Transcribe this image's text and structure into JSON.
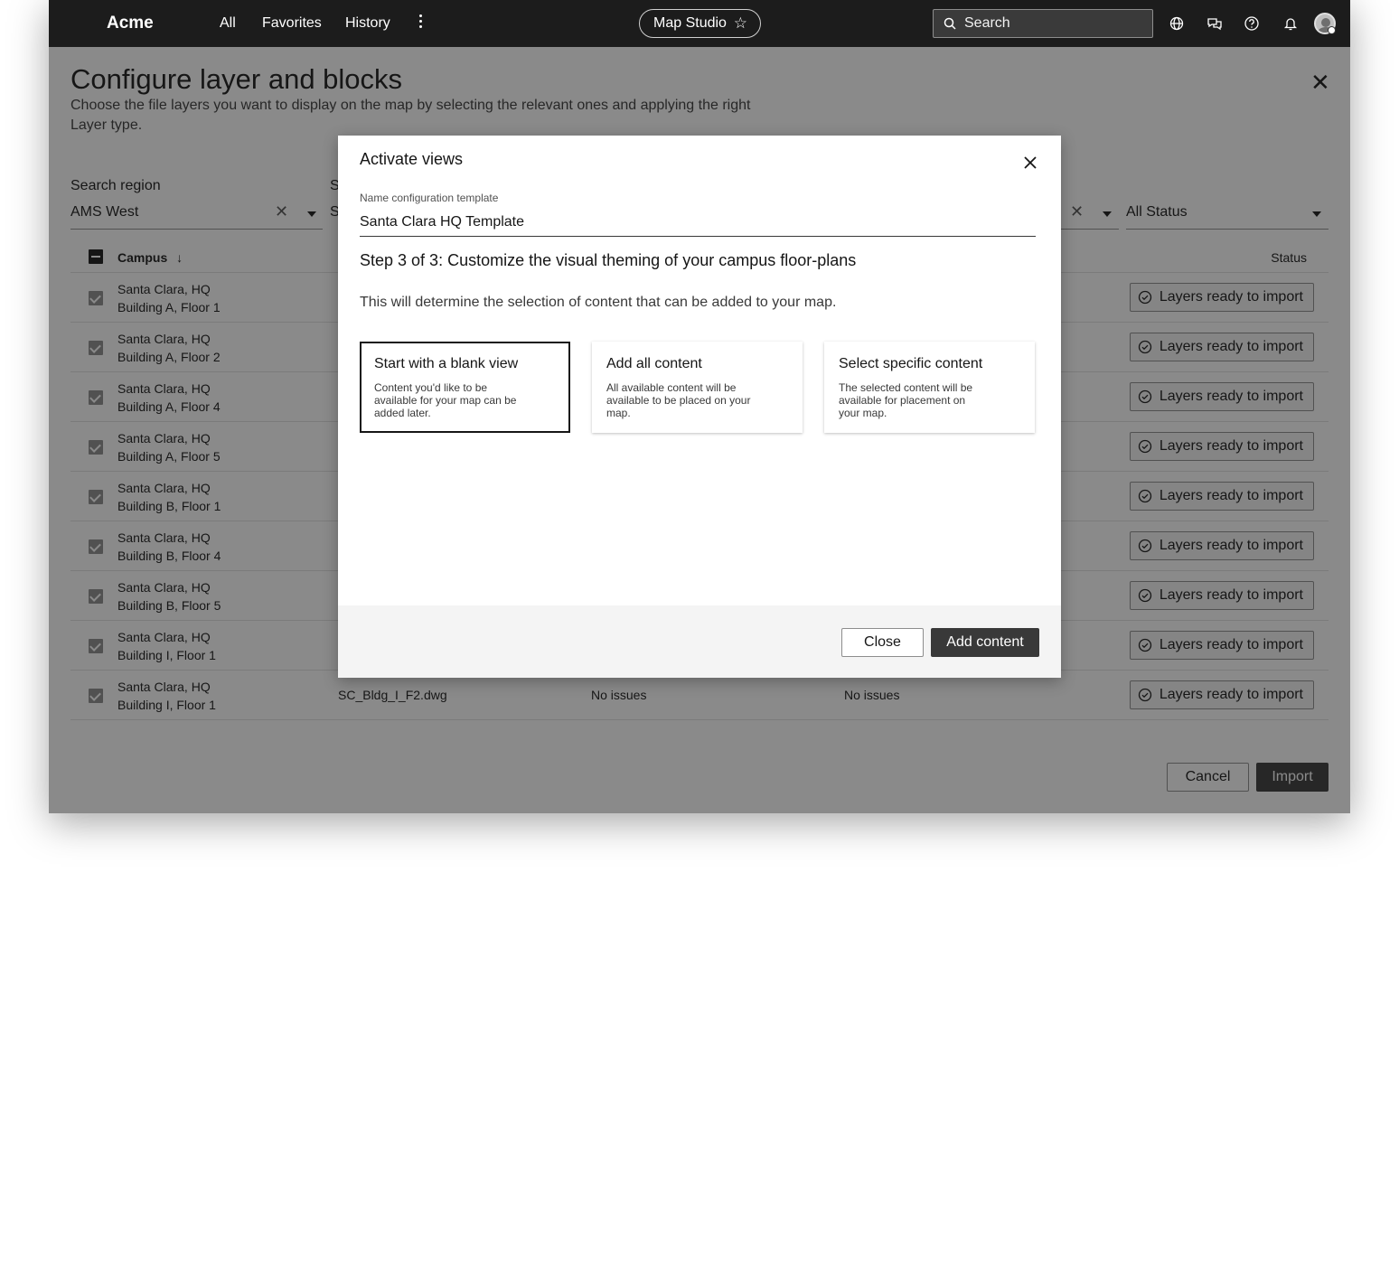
{
  "topbar": {
    "brand": "Acme",
    "nav": [
      "All",
      "Favorites",
      "History"
    ],
    "product": "Map Studio",
    "search_placeholder": "Search"
  },
  "page": {
    "title": "Configure layer and blocks",
    "description": "Choose the file layers you want to display on the map by selecting the relevant ones and applying the right Layer type.",
    "filters": {
      "region_label": "Search region",
      "region_value": "AMS West",
      "site_label": "S",
      "site_value": "S",
      "status_value": "All Status"
    },
    "table": {
      "col_campus": "Campus",
      "col_status": "Status",
      "rows": [
        {
          "campus": "Santa Clara, HQ",
          "building": "Building A, Floor 1",
          "file": "",
          "issues1": "",
          "issues2": "",
          "status": "Layers ready to import"
        },
        {
          "campus": "Santa Clara, HQ",
          "building": "Building A, Floor 2",
          "file": "",
          "issues1": "",
          "issues2": "",
          "status": "Layers ready to import"
        },
        {
          "campus": "Santa Clara, HQ",
          "building": "Building A, Floor 4",
          "file": "",
          "issues1": "",
          "issues2": "",
          "status": "Layers ready to import"
        },
        {
          "campus": "Santa Clara, HQ",
          "building": "Building A, Floor 5",
          "file": "",
          "issues1": "",
          "issues2": "",
          "status": "Layers ready to import"
        },
        {
          "campus": "Santa Clara, HQ",
          "building": "Building B, Floor 1",
          "file": "",
          "issues1": "",
          "issues2": "",
          "status": "Layers ready to import"
        },
        {
          "campus": "Santa Clara, HQ",
          "building": "Building B, Floor 4",
          "file": "",
          "issues1": "",
          "issues2": "",
          "status": "Layers ready to import"
        },
        {
          "campus": "Santa Clara, HQ",
          "building": "Building B, Floor 5",
          "file": "",
          "issues1": "",
          "issues2": "",
          "status": "Layers ready to import"
        },
        {
          "campus": "Santa Clara, HQ",
          "building": "Building I, Floor 1",
          "file": "",
          "issues1": "",
          "issues2": "",
          "status": "Layers ready to import"
        },
        {
          "campus": "Santa Clara, HQ",
          "building": "Building I, Floor 1",
          "file": "SC_Bldg_I_F2.dwg",
          "issues1": "No issues",
          "issues2": "No issues",
          "status": "Layers ready to import"
        }
      ]
    },
    "actions": {
      "cancel": "Cancel",
      "import": "Import"
    }
  },
  "modal": {
    "title": "Activate views",
    "field_label": "Name configuration template",
    "field_value": "Santa Clara HQ Template",
    "step": "Step 3 of 3: Customize the visual theming of your campus floor-plans",
    "step_desc": "This will determine the selection of content that can be added to your map.",
    "options": [
      {
        "title": "Start with a blank view",
        "desc": "Content you'd like to be available for your map can be added later.",
        "selected": true
      },
      {
        "title": "Add all content",
        "desc": "All available content will be available to be placed on your map.",
        "selected": false
      },
      {
        "title": "Select specific content",
        "desc": "The selected content will be available for placement on your map.",
        "selected": false
      }
    ],
    "close_label": "Close",
    "primary_label": "Add content"
  }
}
